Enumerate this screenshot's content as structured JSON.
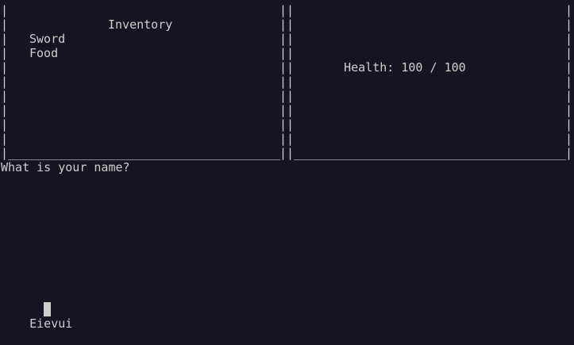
{
  "left_panel": {
    "title": "Inventory",
    "items": [
      "Sword",
      "Food"
    ]
  },
  "right_panel": {
    "health_label": "Health:",
    "health_current": "100",
    "health_separator": "/",
    "health_max": "100"
  },
  "prompt": {
    "question": "What is your name?",
    "input_value": "Eievui"
  },
  "colors": {
    "background": "#171421",
    "foreground": "#d0cfcc",
    "cursor": "#d0cfcc"
  }
}
